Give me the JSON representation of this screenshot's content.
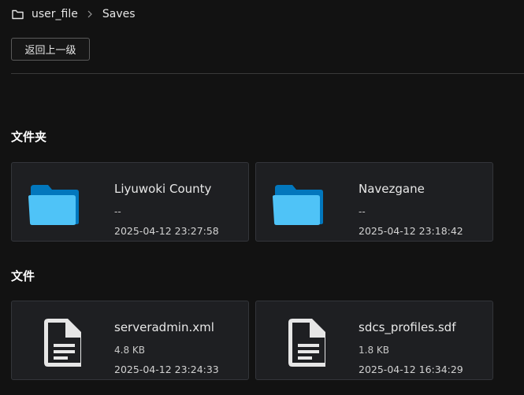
{
  "breadcrumb": {
    "items": [
      "user_file",
      "Saves"
    ]
  },
  "toolbar": {
    "back_label": "返回上一级"
  },
  "sections": {
    "folders_title": "文件夹",
    "files_title": "文件"
  },
  "folders": [
    {
      "name": "Liyuwoki County",
      "size": "--",
      "modified": "2025-04-12 23:27:58"
    },
    {
      "name": "Navezgane",
      "size": "--",
      "modified": "2025-04-12 23:18:42"
    }
  ],
  "files": [
    {
      "name": "serveradmin.xml",
      "size": "4.8 KB",
      "modified": "2025-04-12 23:24:33"
    },
    {
      "name": "sdcs_profiles.sdf",
      "size": "1.8 KB",
      "modified": "2025-04-12 16:34:29"
    }
  ],
  "icons": {
    "breadcrumb_root": "folder-outline-icon",
    "breadcrumb_separator": "chevron-right-icon",
    "folder": "folder-icon",
    "file": "document-icon"
  },
  "colors": {
    "background": "#121212",
    "card_background": "#1e1f22",
    "folder_front": "#4fc3f7",
    "folder_back": "#0277bd",
    "file_icon": "#e6e6e6"
  }
}
